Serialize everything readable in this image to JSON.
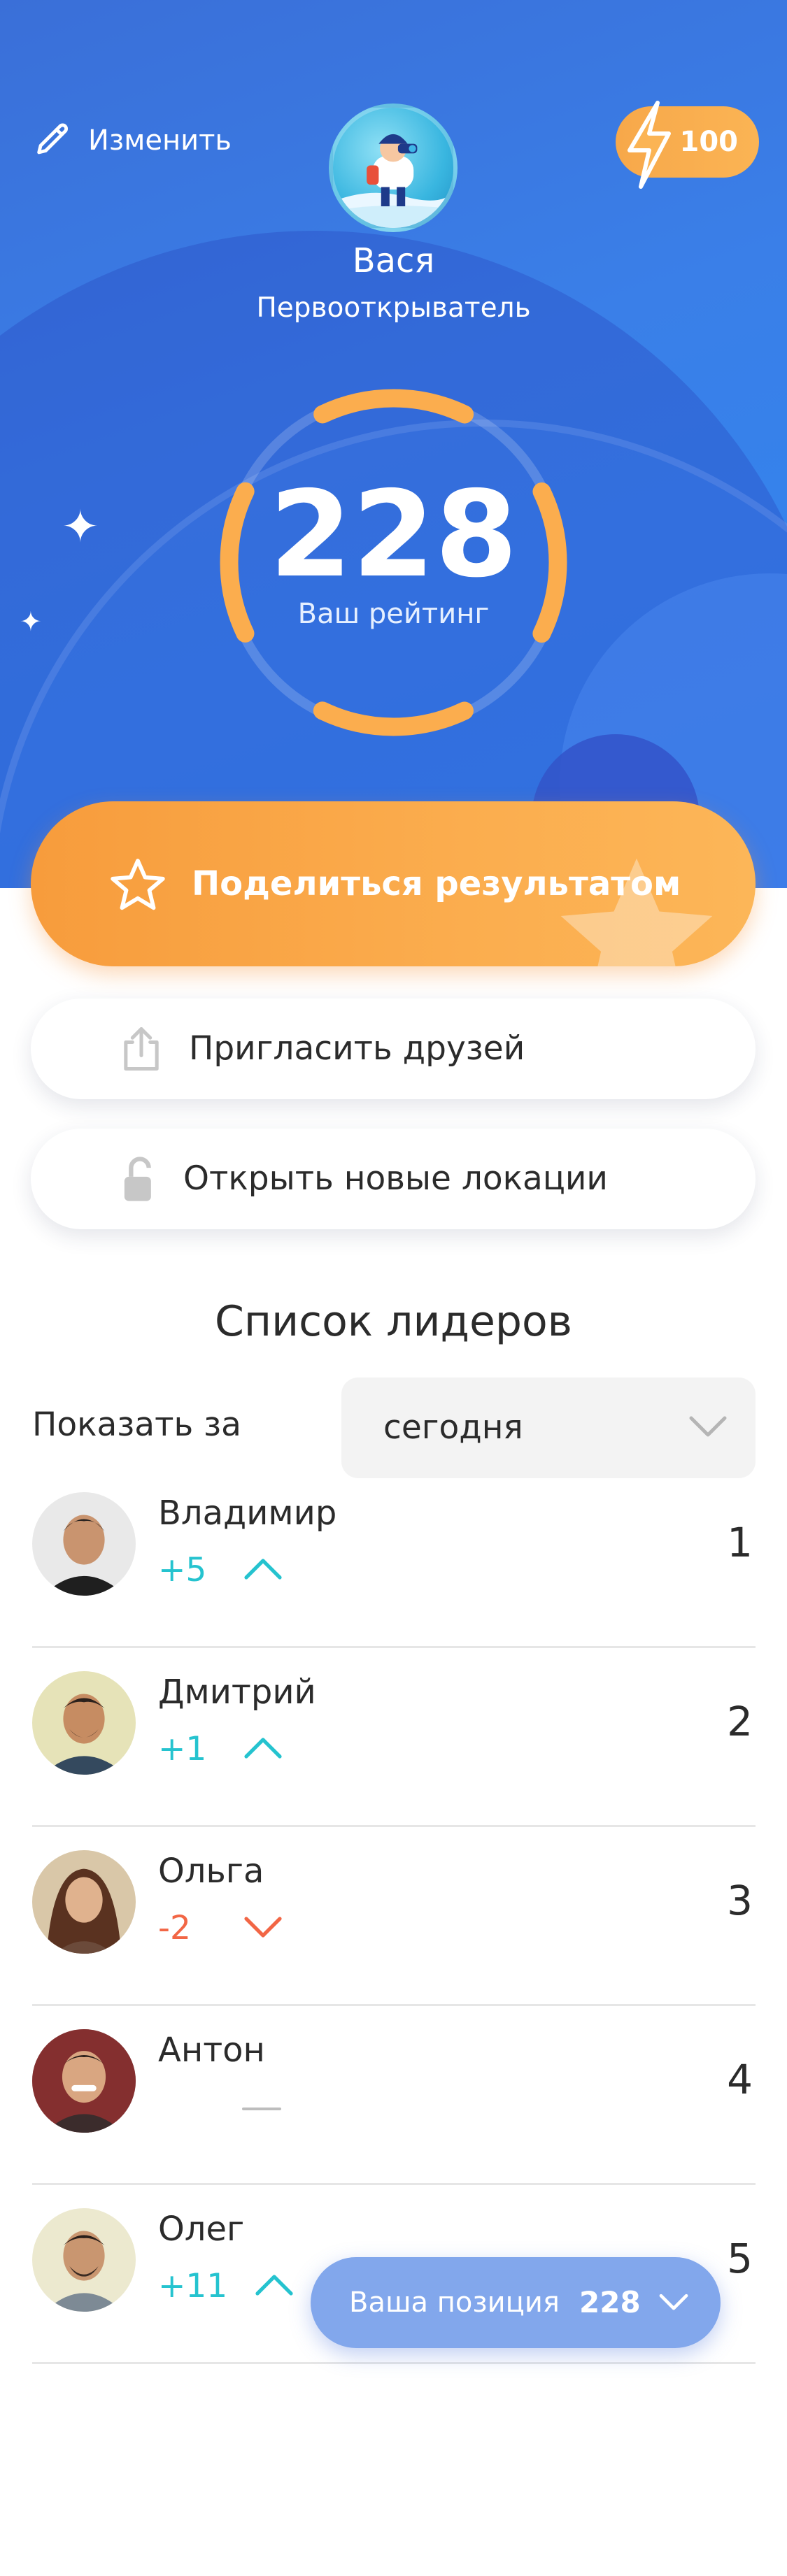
{
  "header": {
    "edit_label": "Изменить",
    "energy_value": "100",
    "user_name": "Вася",
    "user_title": "Первооткрыватель",
    "score": "228",
    "score_label": "Ваш рейтинг"
  },
  "actions": {
    "share_label": "Поделиться результатом",
    "invite_label": "Пригласить друзей",
    "unlock_label": "Открыть новые локации"
  },
  "leaders": {
    "title": "Список лидеров",
    "show_for_label": "Показать за",
    "period_value": "сегодня",
    "rows": [
      {
        "name": "Владимир",
        "delta": "+5",
        "trend": "up",
        "rank": "1"
      },
      {
        "name": "Дмитрий",
        "delta": "+1",
        "trend": "up",
        "rank": "2"
      },
      {
        "name": "Ольга",
        "delta": "-2",
        "trend": "down",
        "rank": "3"
      },
      {
        "name": "Антон",
        "delta": "",
        "trend": "flat",
        "rank": "4"
      },
      {
        "name": "Олег",
        "delta": "+11",
        "trend": "up",
        "rank": "5"
      }
    ]
  },
  "position": {
    "label": "Ваша позиция",
    "value": "228"
  },
  "colors": {
    "hero_blue": "#3a7fe8",
    "accent_orange": "#fbad4e",
    "trend_up": "#25c3cf",
    "trend_down": "#f26645"
  }
}
